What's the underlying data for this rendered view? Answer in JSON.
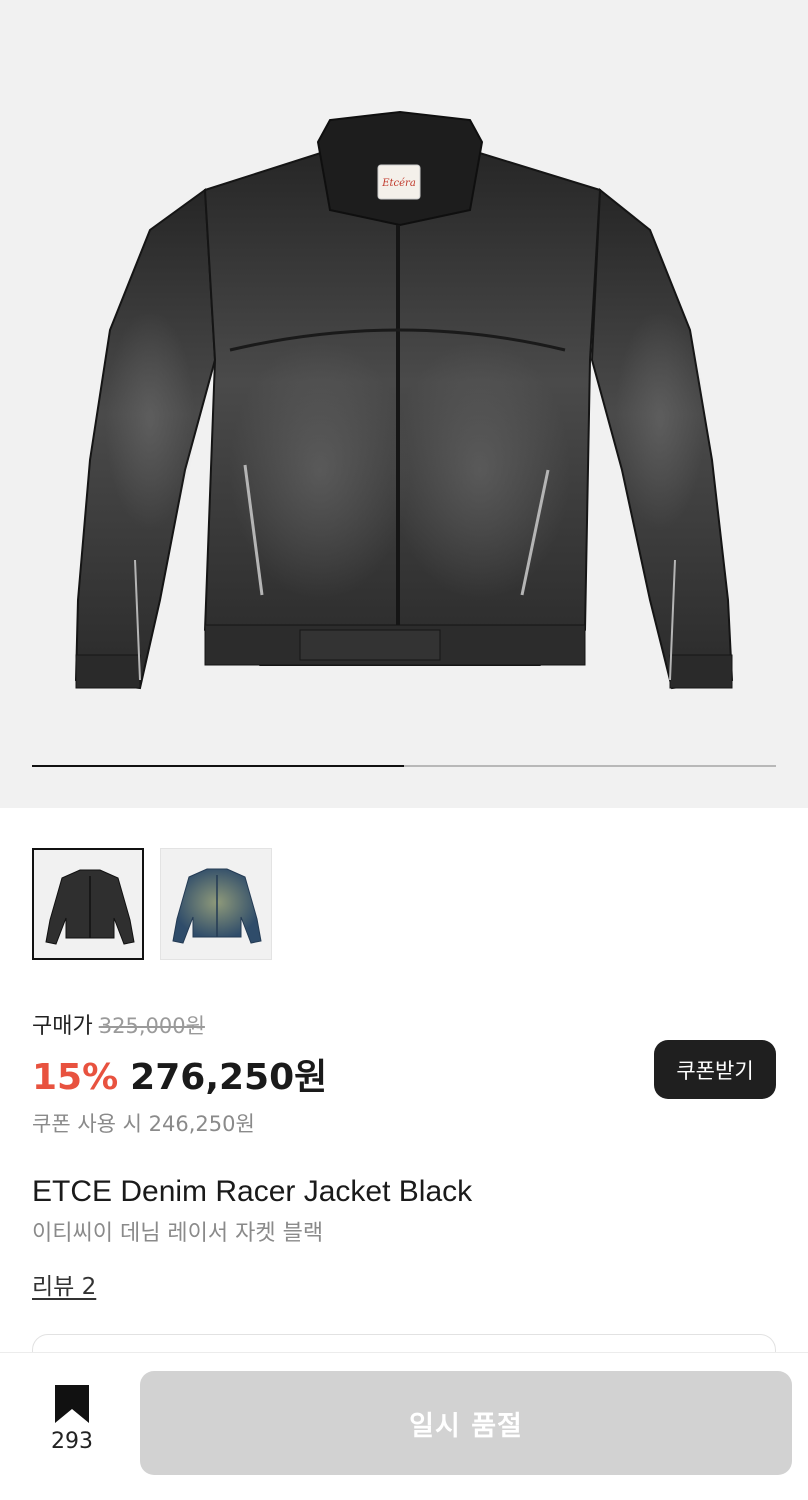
{
  "gallery": {
    "current_index": 1,
    "total_images": 2,
    "progress_fraction": 0.5,
    "background_color": "#f1f1f1",
    "jacket_tag_text": "Etcéra"
  },
  "thumbnails": [
    {
      "variant": "black-denim",
      "selected": true
    },
    {
      "variant": "blue-denim",
      "selected": false
    }
  ],
  "price": {
    "label": "구매가",
    "original": "325,000원",
    "discount_rate": "15%",
    "sale": "276,250원",
    "coupon_price_text": "쿠폰 사용 시 246,250원",
    "discount_color": "#e8523f"
  },
  "coupon_button": {
    "label": "쿠폰받기"
  },
  "product": {
    "name_en": "ETCE Denim Racer Jacket Black",
    "name_ko": "이티씨이 데님 레이서 자켓 블랙",
    "review_link": "리뷰 2"
  },
  "bottom_bar": {
    "bookmark_icon": "bookmark-icon",
    "bookmark_count": "293",
    "primary_button": "일시 품절"
  }
}
